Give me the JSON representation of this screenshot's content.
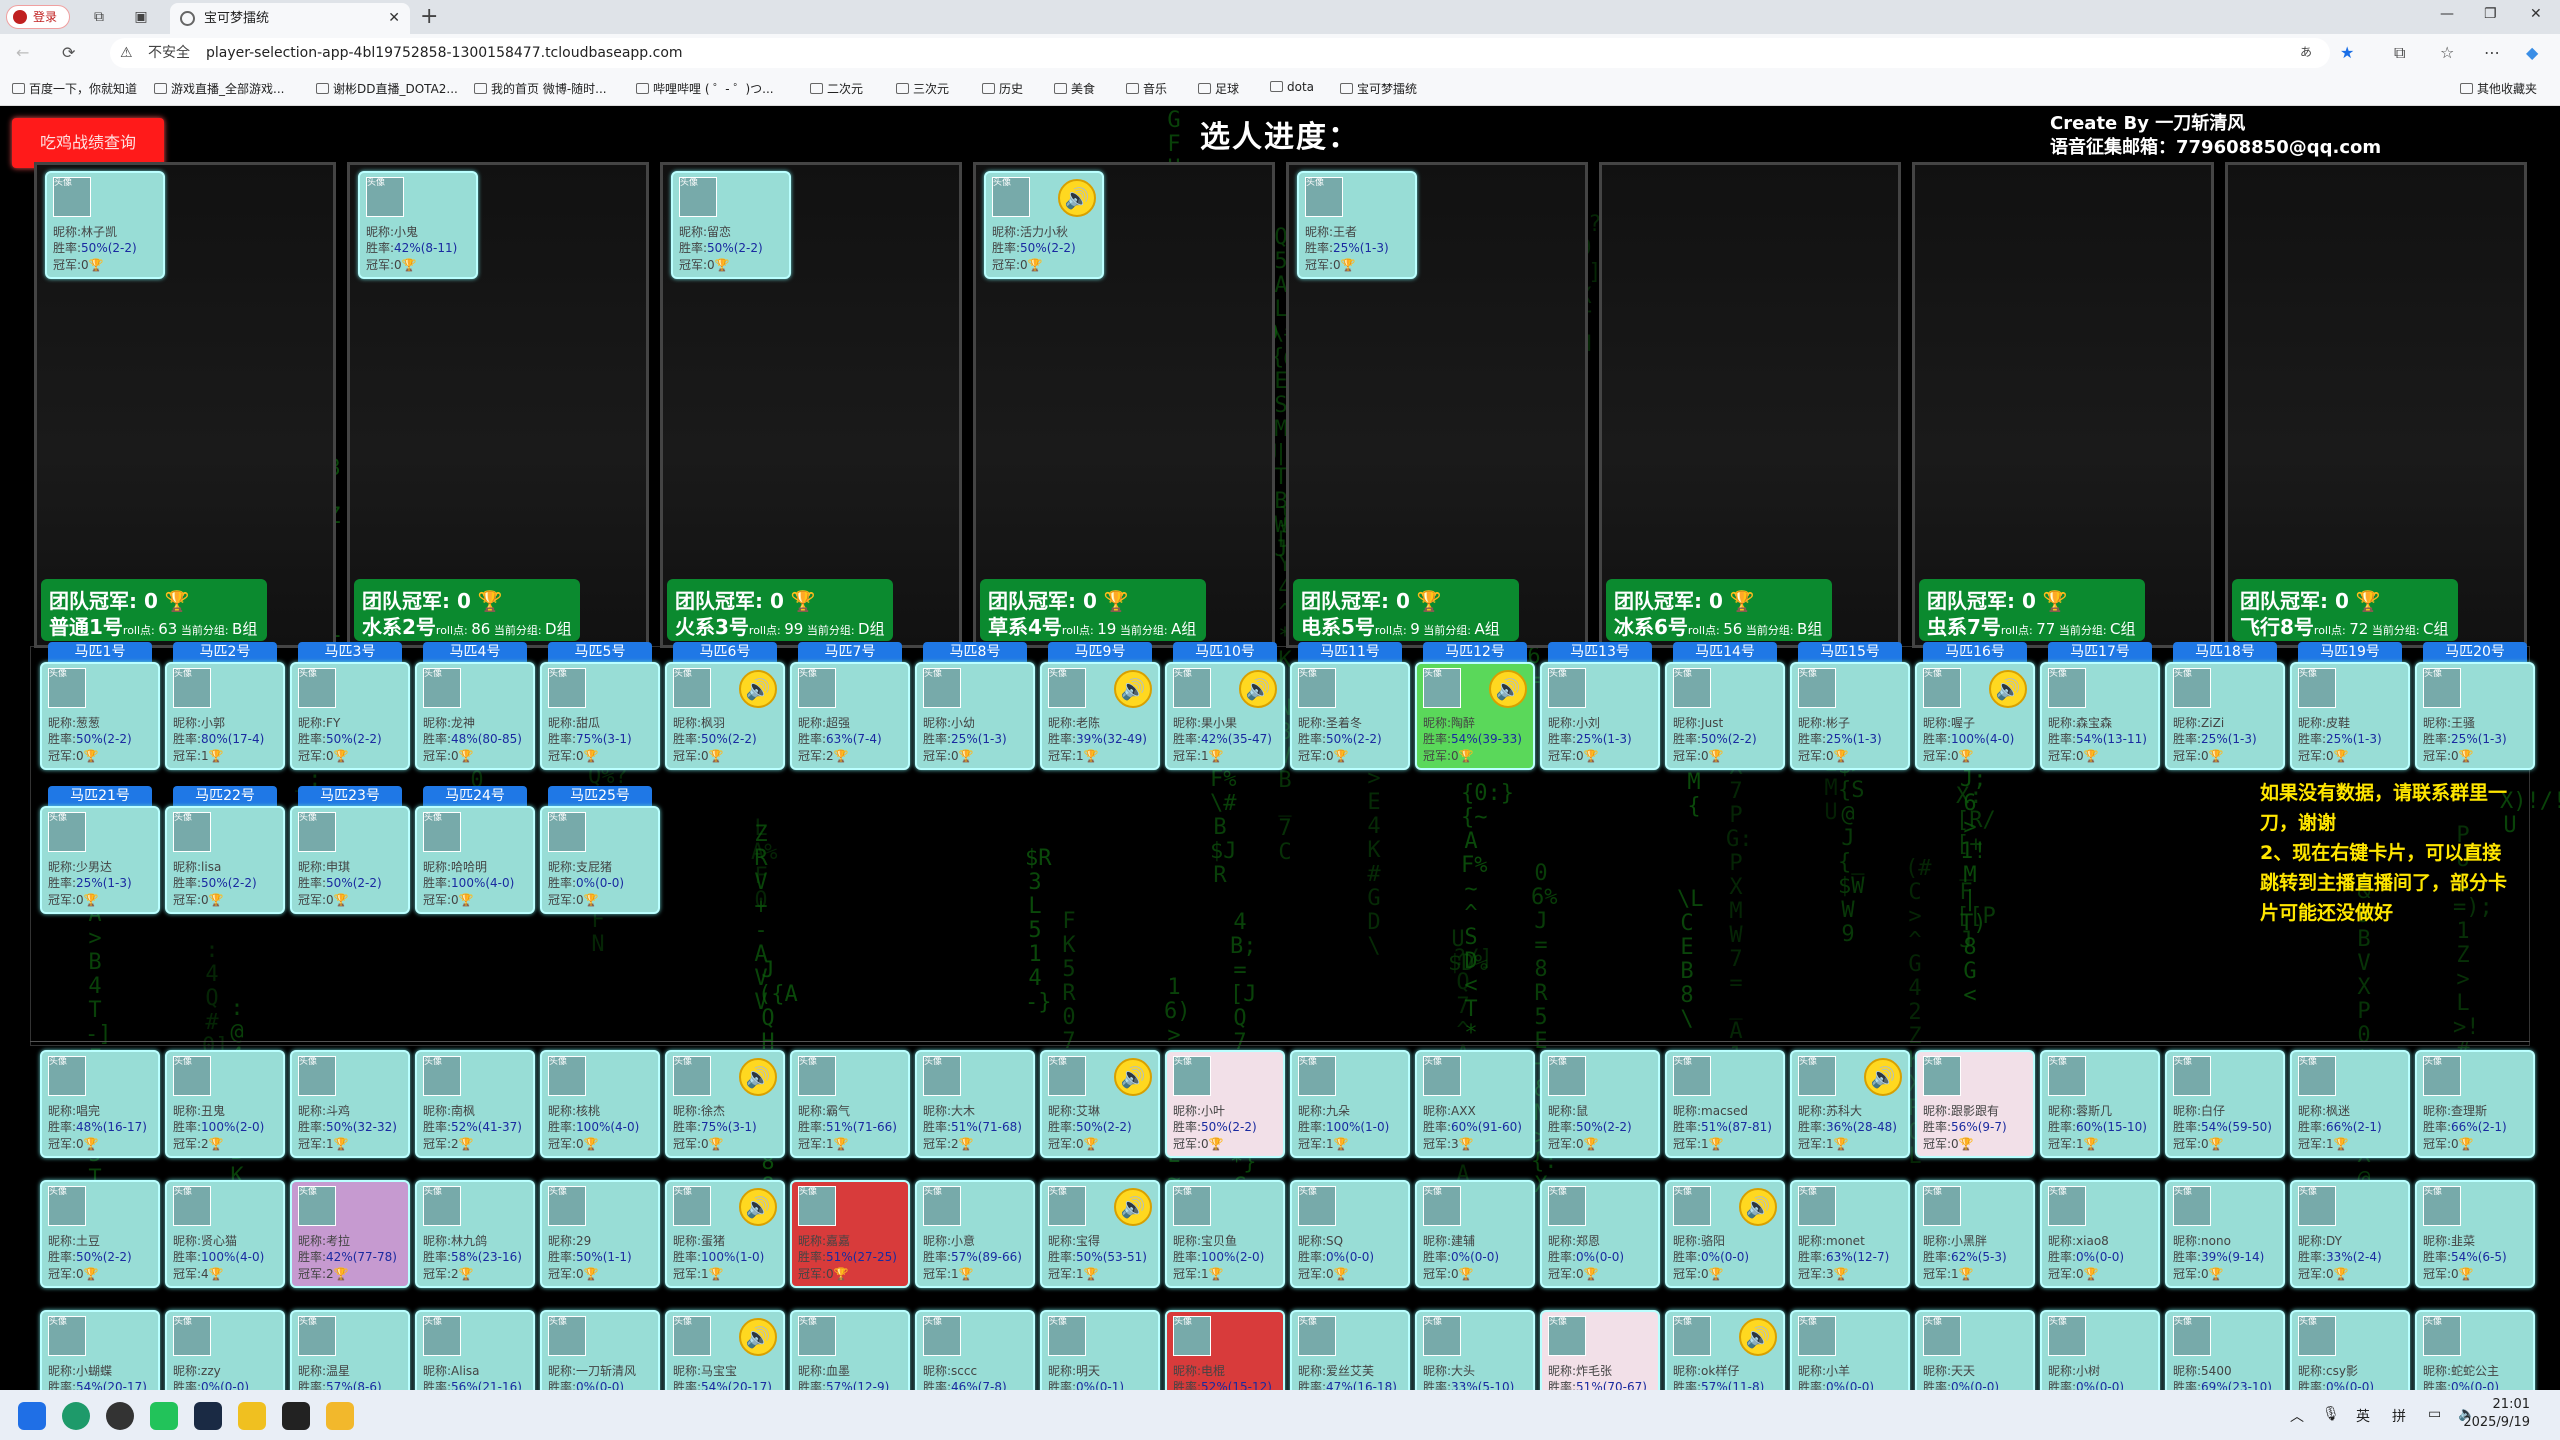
{
  "browser": {
    "profile": "登录",
    "tab_title": "宝可梦擂统",
    "url_insecure": "不安全",
    "url": "player-selection-app-4bl19752858-1300158477.tcloudbaseapp.com",
    "bookmarks": [
      "百度一下，你就知道",
      "游戏直播_全部游戏...",
      "谢彬DD直播_DOTA2...",
      "我的首页 微博-随时...",
      "哔哩哔哩 ( ゜- ゜)つ...",
      "二次元",
      "三次元",
      "历史",
      "美食",
      "音乐",
      "足球",
      "dota",
      "宝可梦擂统"
    ],
    "other_bookmarks": "其他收藏夹"
  },
  "page": {
    "query_button": "吃鸡战绩查询",
    "progress_title": "选人进度：",
    "credit_line1": "Create By 一刀斩清风",
    "credit_line2": "语音征集邮箱：779608850@qq.com",
    "notice": "如果没有数据，请联系群里一刀，谢谢\n2、现在右键卡片，可以直接跳转到主播直播间了，部分卡片可能还没做好"
  },
  "labels": {
    "nick": "昵称:",
    "rate": "胜率:",
    "champ": "冠军:",
    "avatar_alt": "头像"
  },
  "teams": [
    {
      "champ": "团队冠军: 0 🏆",
      "name": "普通1号",
      "roll_label": "roll点: ",
      "roll": "63",
      "score_label": " 当前分组: ",
      "group": "B组",
      "player": {
        "nick": "林子凯",
        "rate": "50%(2-2)",
        "champ": "0",
        "avatar": "头像"
      }
    },
    {
      "champ": "团队冠军: 0 🏆",
      "name": "水系2号",
      "roll_label": "roll点: ",
      "roll": "86",
      "score_label": " 当前分组: ",
      "group": "D组",
      "player": {
        "nick": "小鬼",
        "rate": "42%(8-11)",
        "champ": "0"
      }
    },
    {
      "champ": "团队冠军: 0 🏆",
      "name": "火系3号",
      "roll_label": "roll点: ",
      "roll": "99",
      "score_label": " 当前分组: ",
      "group": "D组",
      "player": {
        "nick": "留恋",
        "rate": "50%(2-2)",
        "champ": "0"
      }
    },
    {
      "champ": "团队冠军: 0 🏆",
      "name": "草系4号",
      "roll_label": "roll点: ",
      "roll": "19",
      "score_label": " 当前分组: ",
      "group": "A组",
      "player": {
        "nick": "活力小秋",
        "rate": "50%(2-2)",
        "champ": "0",
        "voice": true
      }
    },
    {
      "champ": "团队冠军: 0 🏆",
      "name": "电系5号",
      "roll_label": "roll点: ",
      "roll": "9",
      "score_label": " 当前分组: ",
      "group": "A组",
      "player": {
        "nick": "王者",
        "rate": "25%(1-3)",
        "champ": "0"
      }
    },
    {
      "champ": "团队冠军: 0 🏆",
      "name": "冰系6号",
      "roll_label": "roll点: ",
      "roll": "56",
      "score_label": " 当前分组: ",
      "group": "B组"
    },
    {
      "champ": "团队冠军: 0 🏆",
      "name": "虫系7号",
      "roll_label": "roll点: ",
      "roll": "77",
      "score_label": " 当前分组: ",
      "group": "C组"
    },
    {
      "champ": "团队冠军: 0 🏆",
      "name": "飞行8号",
      "roll_label": "roll点: ",
      "roll": "72",
      "score_label": " 当前分组: ",
      "group": "C组"
    }
  ],
  "horses": [
    {
      "label": "马匹1号",
      "nick": "葱葱",
      "rate": "50%(2-2)",
      "champ": "0"
    },
    {
      "label": "马匹2号",
      "nick": "小郭",
      "rate": "80%(17-4)",
      "champ": "1"
    },
    {
      "label": "马匹3号",
      "nick": "FY",
      "rate": "50%(2-2)",
      "champ": "0"
    },
    {
      "label": "马匹4号",
      "nick": "龙神",
      "rate": "48%(80-85)",
      "champ": "0"
    },
    {
      "label": "马匹5号",
      "nick": "甜瓜",
      "rate": "75%(3-1)",
      "champ": "0"
    },
    {
      "label": "马匹6号",
      "nick": "枫羽",
      "rate": "50%(2-2)",
      "champ": "0",
      "voice": true
    },
    {
      "label": "马匹7号",
      "nick": "超强",
      "rate": "63%(7-4)",
      "champ": "2"
    },
    {
      "label": "马匹8号",
      "nick": "小幼",
      "rate": "25%(1-3)",
      "champ": "0"
    },
    {
      "label": "马匹9号",
      "nick": "老陈",
      "rate": "39%(32-49)",
      "champ": "1",
      "voice": true
    },
    {
      "label": "马匹10号",
      "nick": "果小果",
      "rate": "42%(35-47)",
      "champ": "1",
      "voice": true
    },
    {
      "label": "马匹11号",
      "nick": "圣着冬",
      "rate": "50%(2-2)",
      "champ": "0"
    },
    {
      "label": "马匹12号",
      "nick": "陶醉",
      "rate": "54%(39-33)",
      "champ": "0",
      "voice": true,
      "green": true
    },
    {
      "label": "马匹13号",
      "nick": "小刘",
      "rate": "25%(1-3)",
      "champ": "0"
    },
    {
      "label": "马匹14号",
      "nick": "Just",
      "rate": "50%(2-2)",
      "champ": "0"
    },
    {
      "label": "马匹15号",
      "nick": "彬子",
      "rate": "25%(1-3)",
      "champ": "0"
    },
    {
      "label": "马匹16号",
      "nick": "喔子",
      "rate": "100%(4-0)",
      "champ": "0",
      "voice": true
    },
    {
      "label": "马匹17号",
      "nick": "森宝森",
      "rate": "54%(13-11)",
      "champ": "0"
    },
    {
      "label": "马匹18号",
      "nick": "ZiZi",
      "rate": "25%(1-3)",
      "champ": "0"
    },
    {
      "label": "马匹19号",
      "nick": "皮鞋",
      "rate": "25%(1-3)",
      "champ": "0"
    },
    {
      "label": "马匹20号",
      "nick": "王骚",
      "rate": "25%(1-3)",
      "champ": "0"
    },
    {
      "label": "马匹21号",
      "nick": "少男达",
      "rate": "25%(1-3)",
      "champ": "0"
    },
    {
      "label": "马匹22号",
      "nick": "lisa",
      "rate": "50%(2-2)",
      "champ": "0"
    },
    {
      "label": "马匹23号",
      "nick": "申琪",
      "rate": "50%(2-2)",
      "champ": "0"
    },
    {
      "label": "马匹24号",
      "nick": "哈哈明",
      "rate": "100%(4-0)",
      "champ": "0"
    },
    {
      "label": "马匹25号",
      "nick": "支屁猪",
      "rate": "0%(0-0)",
      "champ": "0"
    }
  ],
  "pool": [
    {
      "nick": "唱完",
      "rate": "48%(16-17)",
      "champ": "0"
    },
    {
      "nick": "丑鬼",
      "rate": "100%(2-0)",
      "champ": "2"
    },
    {
      "nick": "斗鸡",
      "rate": "50%(32-32)",
      "champ": "1"
    },
    {
      "nick": "南枫",
      "rate": "52%(41-37)",
      "champ": "2"
    },
    {
      "nick": "核桃",
      "rate": "100%(4-0)",
      "champ": "0"
    },
    {
      "nick": "徐杰",
      "rate": "75%(3-1)",
      "champ": "0",
      "voice": true
    },
    {
      "nick": "霸气",
      "rate": "51%(71-66)",
      "champ": "1"
    },
    {
      "nick": "大木",
      "rate": "51%(71-68)",
      "champ": "2"
    },
    {
      "nick": "艾琳",
      "rate": "50%(2-2)",
      "champ": "0",
      "voice": true
    },
    {
      "nick": "小叶",
      "rate": "50%(2-2)",
      "champ": "0",
      "style": "pic3"
    },
    {
      "nick": "九朵",
      "rate": "100%(1-0)",
      "champ": "1"
    },
    {
      "nick": "AXX",
      "rate": "60%(91-60)",
      "champ": "3"
    },
    {
      "nick": "鼠",
      "rate": "50%(2-2)",
      "champ": "0"
    },
    {
      "nick": "macsed",
      "rate": "51%(87-81)",
      "champ": "1"
    },
    {
      "nick": "苏科大",
      "rate": "36%(28-48)",
      "champ": "1",
      "voice": true
    },
    {
      "nick": "跟影跟有",
      "rate": "56%(9-7)",
      "champ": "0",
      "style": "pic3"
    },
    {
      "nick": "蓉斯几",
      "rate": "60%(15-10)",
      "champ": "1"
    },
    {
      "nick": "白仔",
      "rate": "54%(59-50)",
      "champ": "0"
    },
    {
      "nick": "枫迷",
      "rate": "66%(2-1)",
      "champ": "1"
    },
    {
      "nick": "查理斯",
      "rate": "66%(2-1)",
      "champ": "0"
    },
    {
      "nick": "土豆",
      "rate": "50%(2-2)",
      "champ": "0"
    },
    {
      "nick": "贤心猫",
      "rate": "100%(4-0)",
      "champ": "4"
    },
    {
      "nick": "考拉",
      "rate": "42%(77-78)",
      "champ": "2",
      "style": "pic"
    },
    {
      "nick": "林九鸽",
      "rate": "58%(23-16)",
      "champ": "2"
    },
    {
      "nick": "29",
      "rate": "50%(1-1)",
      "champ": "0"
    },
    {
      "nick": "蛋猪",
      "rate": "100%(1-0)",
      "champ": "1",
      "voice": true
    },
    {
      "nick": "嘉嘉",
      "rate": "51%(27-25)",
      "champ": "0",
      "style": "pic2"
    },
    {
      "nick": "小意",
      "rate": "57%(89-66)",
      "champ": "1"
    },
    {
      "nick": "宝得",
      "rate": "50%(53-51)",
      "champ": "1",
      "voice": true
    },
    {
      "nick": "宝贝鱼",
      "rate": "100%(2-0)",
      "champ": "1"
    },
    {
      "nick": "SQ",
      "rate": "0%(0-0)",
      "champ": "0"
    },
    {
      "nick": "建辅",
      "rate": "0%(0-0)",
      "champ": "0"
    },
    {
      "nick": "郑恩",
      "rate": "0%(0-0)",
      "champ": "0"
    },
    {
      "nick": "骆阳",
      "rate": "0%(0-0)",
      "champ": "0",
      "voice": true
    },
    {
      "nick": "monet",
      "rate": "63%(12-7)",
      "champ": "3"
    },
    {
      "nick": "小黑胖",
      "rate": "62%(5-3)",
      "champ": "1"
    },
    {
      "nick": "xiao8",
      "rate": "0%(0-0)",
      "champ": "0"
    },
    {
      "nick": "nono",
      "rate": "39%(9-14)",
      "champ": "0"
    },
    {
      "nick": "DY",
      "rate": "33%(2-4)",
      "champ": "0"
    },
    {
      "nick": "韭菜",
      "rate": "54%(6-5)",
      "champ": "0"
    },
    {
      "nick": "小蝴蝶",
      "rate": "54%(20-17)",
      "champ": "0"
    },
    {
      "nick": "zzy",
      "rate": "0%(0-0)",
      "champ": "0"
    },
    {
      "nick": "温星",
      "rate": "57%(8-6)",
      "champ": "0"
    },
    {
      "nick": "Alisa",
      "rate": "56%(21-16)",
      "champ": "0"
    },
    {
      "nick": "一刀斩清风",
      "rate": "0%(0-0)",
      "champ": "0"
    },
    {
      "nick": "马宝宝",
      "rate": "54%(20-17)",
      "champ": "0",
      "voice": true
    },
    {
      "nick": "血墨",
      "rate": "57%(12-9)",
      "champ": "0"
    },
    {
      "nick": "sccc",
      "rate": "46%(7-8)",
      "champ": "0"
    },
    {
      "nick": "明天",
      "rate": "0%(0-1)",
      "champ": "0"
    },
    {
      "nick": "电棍",
      "rate": "52%(15-12)",
      "champ": "0",
      "style": "pic2"
    },
    {
      "nick": "爱丝艾芙",
      "rate": "47%(16-18)",
      "champ": "0"
    },
    {
      "nick": "大头",
      "rate": "33%(5-10)",
      "champ": "0"
    },
    {
      "nick": "炸毛张",
      "rate": "51%(70-67)",
      "champ": "0",
      "style": "pic3"
    },
    {
      "nick": "ok样仔",
      "rate": "57%(11-8)",
      "champ": "0",
      "voice": true
    },
    {
      "nick": "小羊",
      "rate": "0%(0-0)",
      "champ": "0"
    },
    {
      "nick": "天天",
      "rate": "0%(0-0)",
      "champ": "0"
    },
    {
      "nick": "小树",
      "rate": "0%(0-0)",
      "champ": "0"
    },
    {
      "nick": "5400",
      "rate": "69%(23-10)",
      "champ": "0"
    },
    {
      "nick": "csy影",
      "rate": "0%(0-0)",
      "champ": "0"
    },
    {
      "nick": "蛇蛇公主",
      "rate": "0%(0-0)",
      "champ": "0"
    }
  ],
  "taskbar": {
    "ime1": "英",
    "ime2": "拼",
    "time": "21:01",
    "date": "2025/9/19"
  },
  "colors": {
    "team_badge": "#0b8a2f",
    "card": "#98ddd6",
    "horse_label": "#1f78e6",
    "query_button": "#ff1a1a",
    "notice": "#ffe600"
  }
}
